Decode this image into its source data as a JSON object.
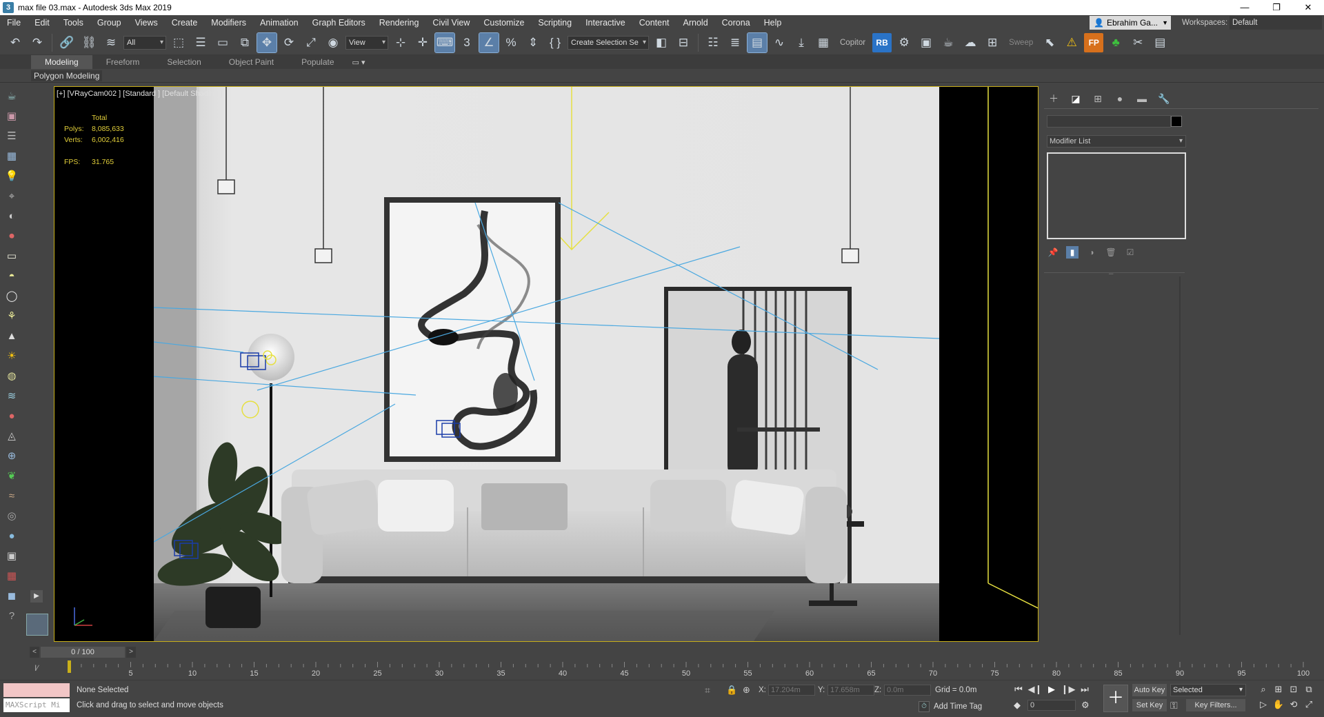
{
  "window": {
    "title": "max file 03.max - Autodesk 3ds Max 2019",
    "buttons": [
      "—",
      "❐",
      "✕"
    ]
  },
  "menu": {
    "items": [
      "File",
      "Edit",
      "Tools",
      "Group",
      "Views",
      "Create",
      "Modifiers",
      "Animation",
      "Graph Editors",
      "Rendering",
      "Civil View",
      "Customize",
      "Scripting",
      "Interactive",
      "Content",
      "Arnold",
      "Corona",
      "Help"
    ],
    "user": "Ebrahim Ga...",
    "workspaces_label": "Workspaces:",
    "workspace": "Default"
  },
  "toolbar": {
    "filter": "All",
    "ref_coord": "View",
    "selection_set": "Create Selection Se",
    "copitor": "Copitor",
    "rb": "RB",
    "sweep": "Sweep",
    "fp": "FP"
  },
  "ribbon": {
    "tabs": [
      "Modeling",
      "Freeform",
      "Selection",
      "Object Paint",
      "Populate"
    ],
    "panel": "Polygon Modeling"
  },
  "viewport": {
    "label": "[+] [VRayCam002 ] [Standard ] [Default Shading ]",
    "stats": {
      "header": "Total",
      "polys_label": "Polys:",
      "polys": "8,085,633",
      "verts_label": "Verts:",
      "verts": "6,002,416",
      "fps_label": "FPS:",
      "fps": "31.765"
    }
  },
  "command_panel": {
    "modifier_list": "Modifier List"
  },
  "time": {
    "frame": "0 / 100",
    "ticks": [
      0,
      5,
      10,
      15,
      20,
      25,
      30,
      35,
      40,
      45,
      50,
      55,
      60,
      65,
      70,
      75,
      80,
      85,
      90,
      95,
      100
    ],
    "current_frame": "0"
  },
  "status": {
    "maxscript": "MAXScript Mi",
    "selection": "None Selected",
    "prompt": "Click and drag to select and move objects",
    "x_label": "X:",
    "x": "17.204m",
    "y_label": "Y:",
    "y": "17.658m",
    "z_label": "Z:",
    "z": "0.0m",
    "grid": "Grid = 0.0m",
    "add_time_tag": "Add Time Tag",
    "auto_key": "Auto Key",
    "set_key": "Set Key",
    "key_selected": "Selected",
    "key_filters": "Key Filters..."
  },
  "colors": {
    "ui_bg": "#444444",
    "viewport_border": "#c9b01a",
    "stats_text": "#e2cf3a",
    "active_button": "#5b7fa8",
    "light_lines": "#4aa8e0",
    "camera_target": "#e6e040"
  }
}
